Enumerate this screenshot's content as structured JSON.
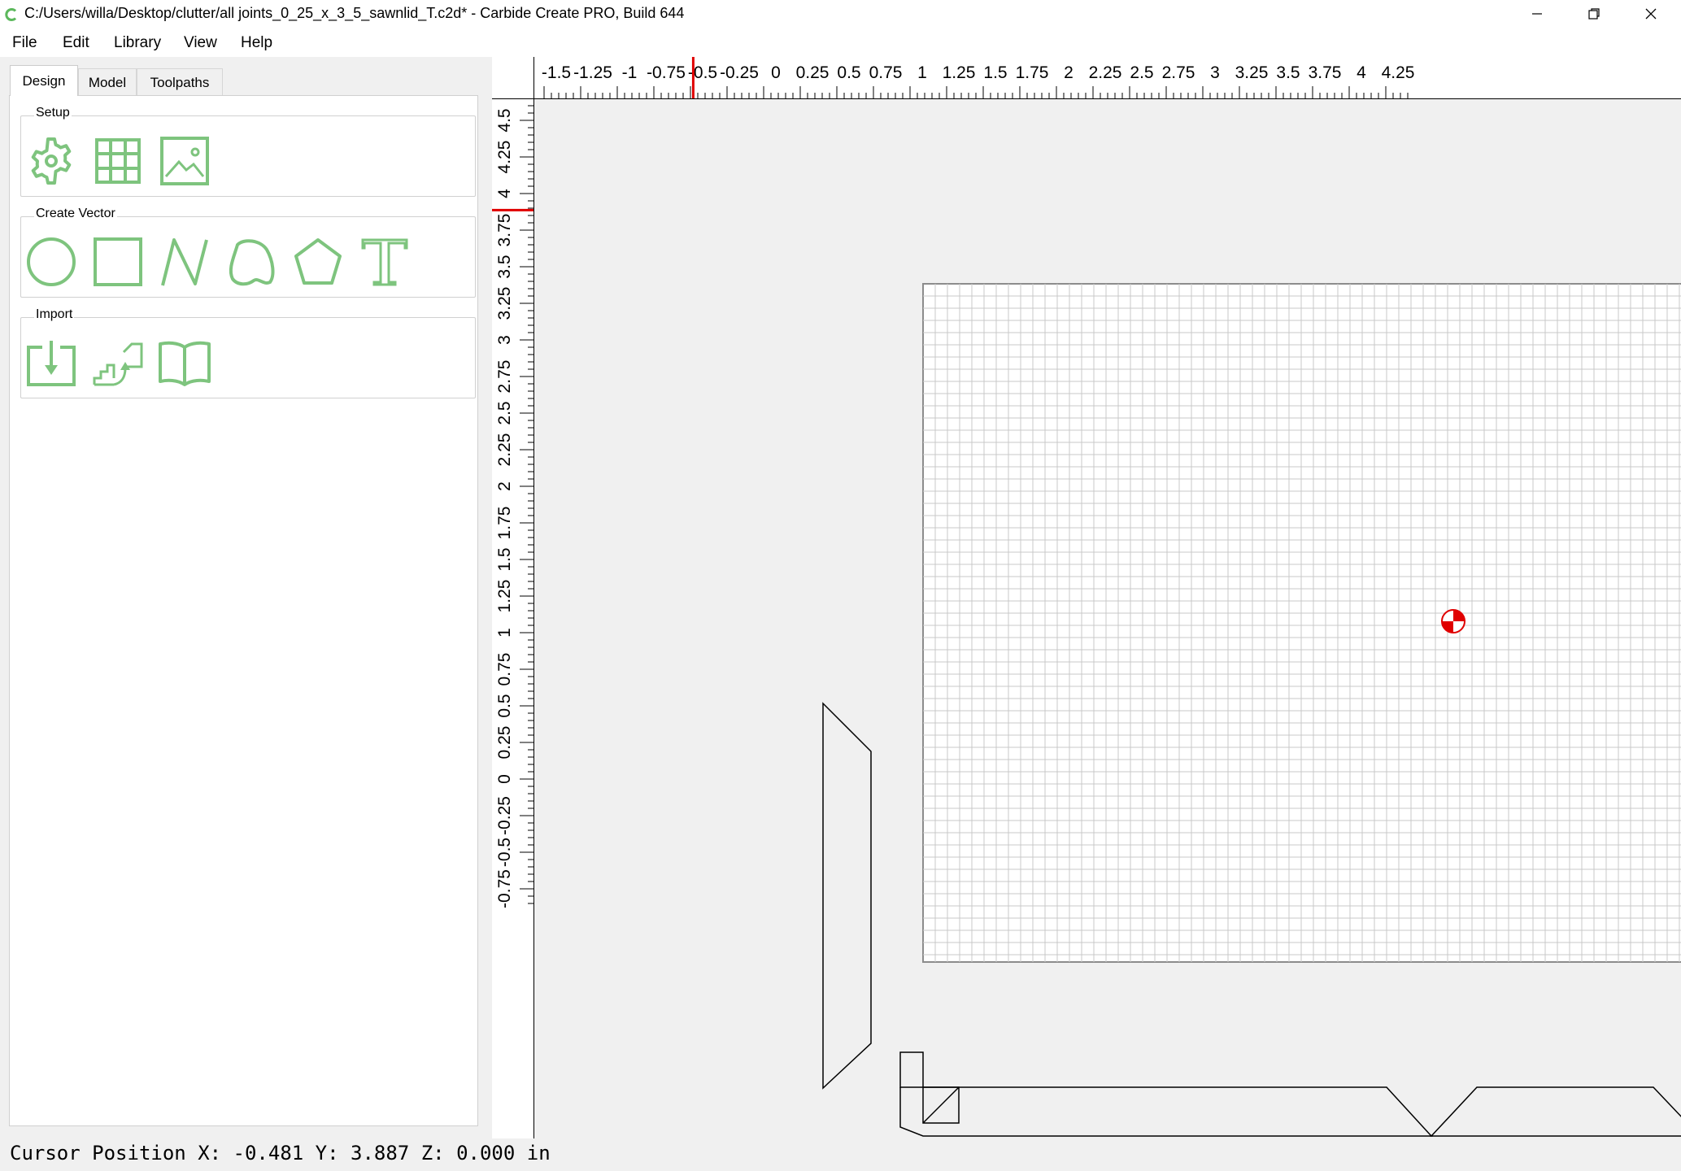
{
  "window": {
    "title": "C:/Users/willa/Desktop/clutter/all joints_0_25_x_3_5_sawnlid_T.c2d* - Carbide Create PRO, Build 644",
    "icons": [
      "app-logo-icon",
      "minimize-icon",
      "restore-icon",
      "close-icon"
    ]
  },
  "menu": {
    "file": "File",
    "edit": "Edit",
    "library": "Library",
    "view": "View",
    "help": "Help"
  },
  "tabs": {
    "design": "Design",
    "model": "Model",
    "toolpaths": "Toolpaths",
    "active": "Design"
  },
  "groups": {
    "setup": {
      "label": "Setup",
      "tools": [
        "job-setup-gear-icon",
        "grid-settings-icon",
        "background-image-icon"
      ]
    },
    "create_vector": {
      "label": "Create Vector",
      "tools": [
        "circle-icon",
        "rectangle-icon",
        "polyline-icon",
        "curve-icon",
        "polygon-icon",
        "text-icon"
      ]
    },
    "import": {
      "label": "Import",
      "tools": [
        "import-file-icon",
        "import-gcode-icon",
        "library-book-icon"
      ]
    }
  },
  "rulers": {
    "horizontal_labels": [
      "-1.5",
      "-1.25",
      "-1",
      "-0.75",
      "-0.5",
      "-0.25",
      "0",
      "0.25",
      "0.5",
      "0.75",
      "1",
      "1.25",
      "1.5",
      "1.75",
      "2",
      "2.25",
      "2.5",
      "2.75",
      "3",
      "3.25",
      "3.5",
      "3.75",
      "4",
      "4.25"
    ],
    "vertical_labels": [
      "4.5",
      "4.25",
      "4",
      "3.75",
      "3.5",
      "3.25",
      "3",
      "2.75",
      "2.5",
      "2.25",
      "2",
      "1.75",
      "1.5",
      "1.25",
      "1",
      "0.75",
      "0.5",
      "0.25",
      "0",
      "-0.25",
      "-0.5",
      "-0.75"
    ],
    "cursor_marker_color": "#e00000"
  },
  "colors": {
    "accent_green": "#7ec47e",
    "origin_red": "#e00000",
    "grid": "#c8c8c8"
  },
  "status": {
    "cursor_position": "Cursor Position X: -0.481 Y: 3.887 Z: 0.000 in"
  }
}
